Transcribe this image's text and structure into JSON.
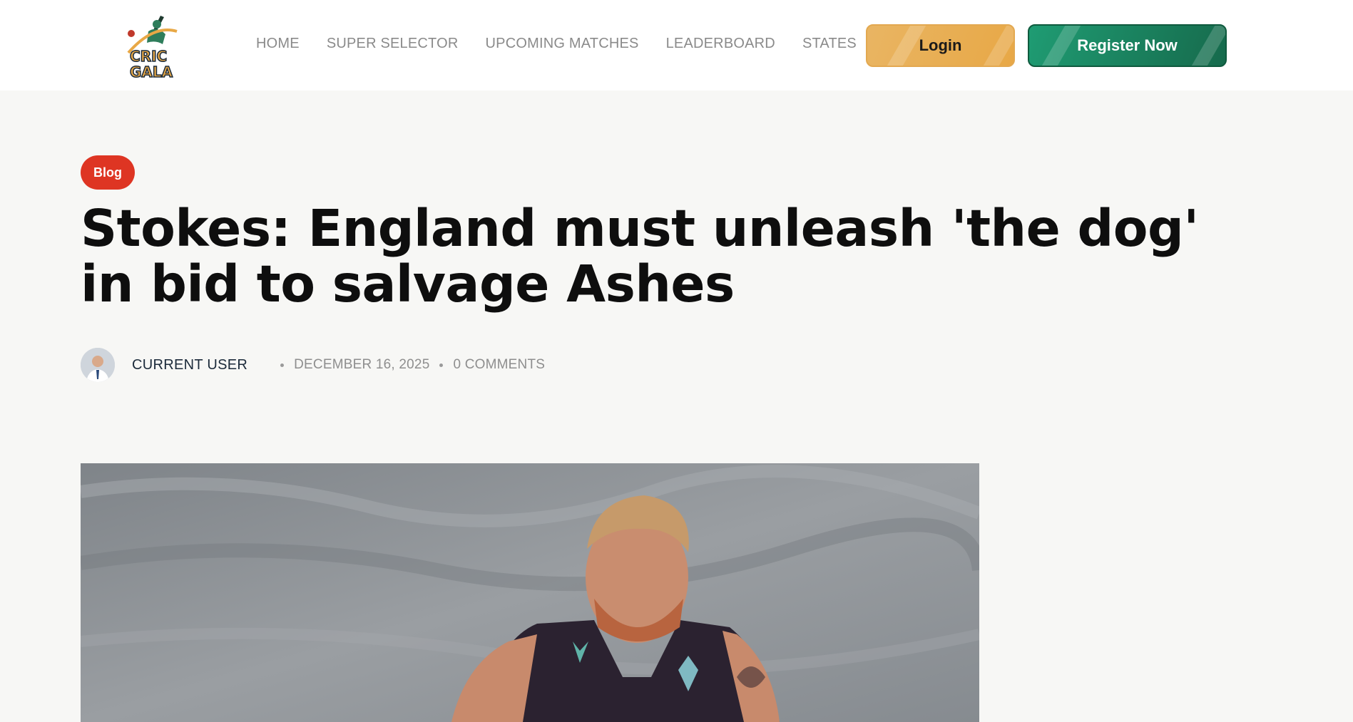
{
  "header": {
    "logo_text": "CRIC GALA",
    "nav": [
      "HOME",
      "SUPER SELECTOR",
      "UPCOMING MATCHES",
      "LEADERBOARD",
      "STATES"
    ],
    "login_label": "Login",
    "register_label": "Register Now"
  },
  "article": {
    "category": "Blog",
    "title": "Stokes: England must unleash 'the dog' in bid to salvage Ashes",
    "author": "CURRENT USER",
    "date": "DECEMBER 16, 2025",
    "comments": "0 COMMENTS"
  },
  "colors": {
    "login": "#e8a846",
    "register": "#1a7f5c",
    "tag": "#de3523",
    "background": "#f7f7f5"
  },
  "icons": [
    "cricket-logo-icon",
    "author-avatar"
  ]
}
